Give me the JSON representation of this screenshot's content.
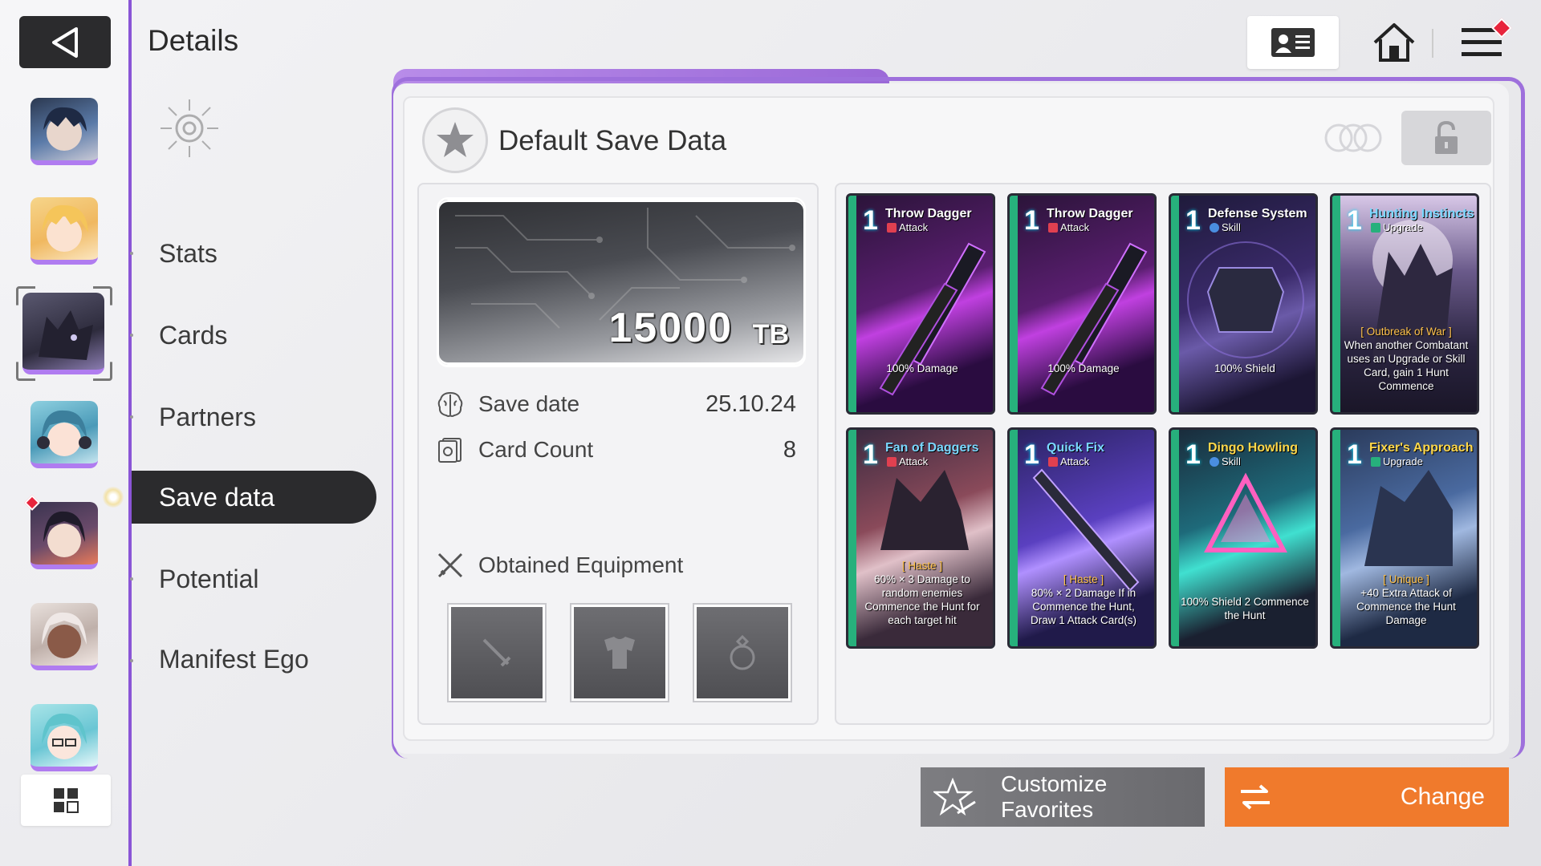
{
  "header": {
    "title": "Details"
  },
  "menu": {
    "items": [
      "Stats",
      "Cards",
      "Partners",
      "Save data",
      "Potential",
      "Manifest Ego"
    ],
    "active": "Save data"
  },
  "save": {
    "title": "Default Save Data",
    "tb_value": "15000",
    "tb_unit": "TB",
    "save_date_label": "Save date",
    "save_date_value": "25.10.24",
    "card_count_label": "Card Count",
    "card_count_value": "8",
    "equipment_label": "Obtained Equipment"
  },
  "cards": [
    {
      "cost": "1",
      "name": "Throw Dagger",
      "type": "Attack",
      "desc_tag": "",
      "desc": "100% Damage"
    },
    {
      "cost": "1",
      "name": "Throw Dagger",
      "type": "Attack",
      "desc_tag": "",
      "desc": "100% Damage"
    },
    {
      "cost": "1",
      "name": "Defense System",
      "type": "Skill",
      "desc_tag": "",
      "desc": "100% Shield"
    },
    {
      "cost": "1",
      "name": "Hunting Instincts",
      "type": "Upgrade",
      "desc_tag": "[ Outbreak of War ]",
      "desc": "When another Combatant uses an Upgrade or Skill Card, gain 1 Hunt Commence"
    },
    {
      "cost": "1",
      "name": "Fan of Daggers",
      "type": "Attack",
      "desc_tag": "[ Haste ]",
      "desc": "60% × 3 Damage to random enemies Commence the Hunt for each target hit"
    },
    {
      "cost": "1",
      "name": "Quick Fix",
      "type": "Attack",
      "desc_tag": "[ Haste ]",
      "desc": "80% × 2 Damage If in Commence the Hunt, Draw 1 Attack Card(s)"
    },
    {
      "cost": "1",
      "name": "Dingo Howling",
      "type": "Skill",
      "desc_tag": "",
      "desc": "100% Shield 2 Commence the Hunt"
    },
    {
      "cost": "1",
      "name": "Fixer's Approach",
      "type": "Upgrade",
      "desc_tag": "[ Unique ]",
      "desc": "+40 Extra Attack of Commence the Hunt Damage"
    }
  ],
  "buttons": {
    "customize": "Customize Favorites",
    "change": "Change"
  },
  "colors": {
    "accent_purple": "#9e70dc",
    "change_orange": "#f07a2c",
    "notif_red": "#e8243c"
  },
  "icons": [
    "back-arrow-icon",
    "profile-card-icon",
    "home-icon",
    "menu-icon",
    "grid-icon",
    "gear-icon",
    "brain-icon",
    "card-icon",
    "crossed-swords-icon",
    "star-icon",
    "lock-icon",
    "swap-icon",
    "sword-icon",
    "armor-icon",
    "ring-icon"
  ]
}
